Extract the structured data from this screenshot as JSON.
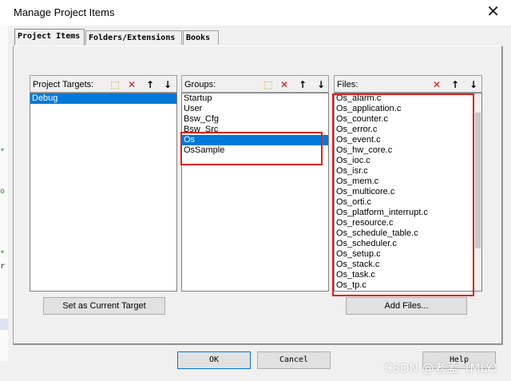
{
  "window": {
    "title": "Manage Project Items",
    "close_glyph": "✕"
  },
  "tabs": [
    {
      "label": "Project Items"
    },
    {
      "label": "Folders/Extensions"
    },
    {
      "label": "Books"
    }
  ],
  "targets": {
    "label": "Project Targets:",
    "items": [
      "Debug"
    ],
    "selected_index": 0,
    "tools": [
      "new-icon",
      "delete-icon",
      "move-up-icon",
      "move-down-icon"
    ]
  },
  "groups": {
    "label": "Groups:",
    "items": [
      "Startup",
      "User",
      "Bsw_Cfg",
      "Bsw_Src",
      "Os",
      "OsSample"
    ],
    "selected_index": 4,
    "tools": [
      "new-icon",
      "delete-icon",
      "move-up-icon",
      "move-down-icon"
    ]
  },
  "files": {
    "label": "Files:",
    "items": [
      "Os_alarm.c",
      "Os_application.c",
      "Os_counter.c",
      "Os_error.c",
      "Os_event.c",
      "Os_hw_core.c",
      "Os_ioc.c",
      "Os_isr.c",
      "Os_mem.c",
      "Os_multicore.c",
      "Os_orti.c",
      "Os_platform_interrupt.c",
      "Os_resource.c",
      "Os_schedule_table.c",
      "Os_scheduler.c",
      "Os_setup.c",
      "Os_stack.c",
      "Os_task.c",
      "Os_tp.c"
    ],
    "tools": [
      "delete-icon",
      "move-up-icon",
      "move-down-icon"
    ]
  },
  "buttons": {
    "set_current": "Set as Current Target",
    "add_files": "Add Files...",
    "ok": "OK",
    "cancel": "Cancel",
    "help": "Help"
  },
  "watermark": "CSDN @老孟（MLY）",
  "colors": {
    "selection": "#0078d7",
    "highlight_box": "#e02020"
  }
}
